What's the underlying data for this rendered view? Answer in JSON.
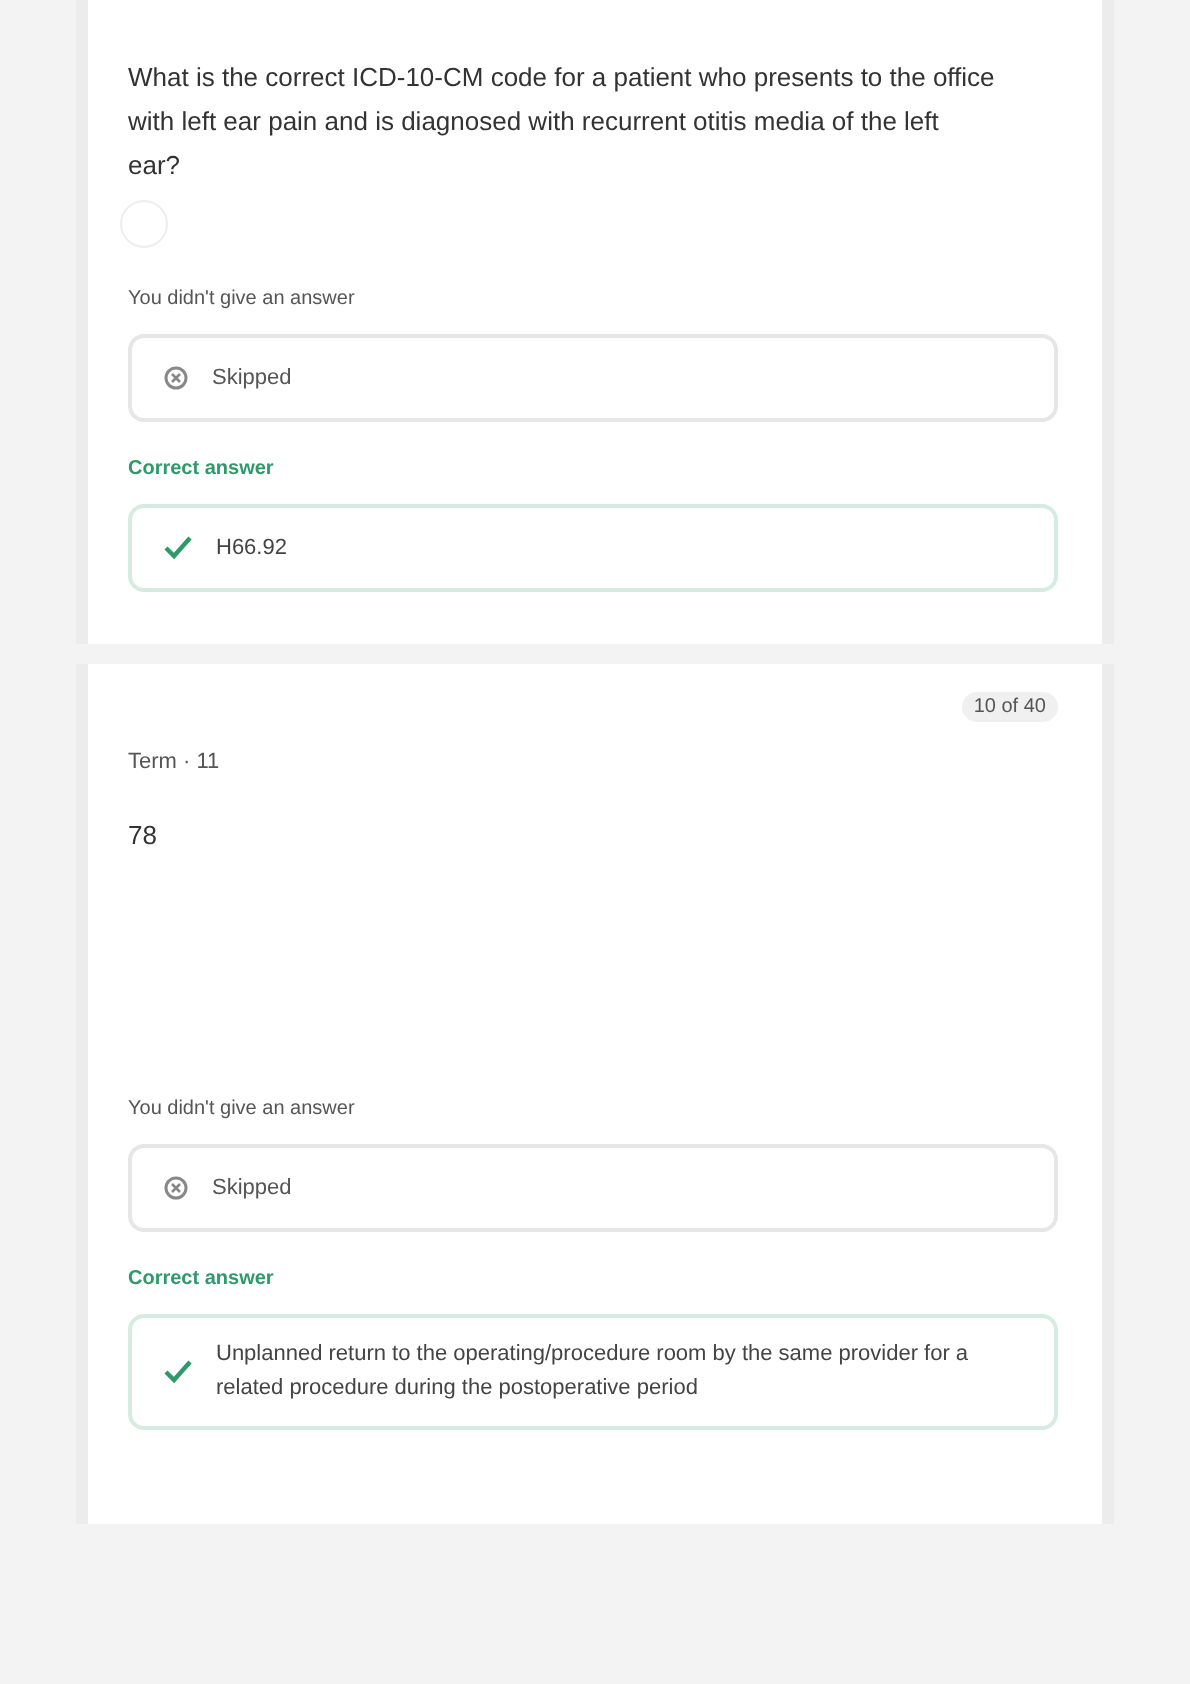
{
  "cards": [
    {
      "prompt": "What is the correct ICD-10-CM code for a patient who presents to the office with left ear pain and is diagnosed with recurrent otitis media of the left ear?",
      "has_audio": true,
      "your_answer_label": "You didn't give an answer",
      "your_answer": "Skipped",
      "correct_label": "Correct answer",
      "correct_answer": "H66.92"
    },
    {
      "counter": "10 of 40",
      "term_label": "Term · 11",
      "prompt": "78",
      "has_audio": false,
      "your_answer_label": "You didn't give an answer",
      "your_answer": "Skipped",
      "correct_label": "Correct answer",
      "correct_answer": "Unplanned return to the operating/procedure room by the same provider for a related procedure during the postoperative period"
    }
  ]
}
